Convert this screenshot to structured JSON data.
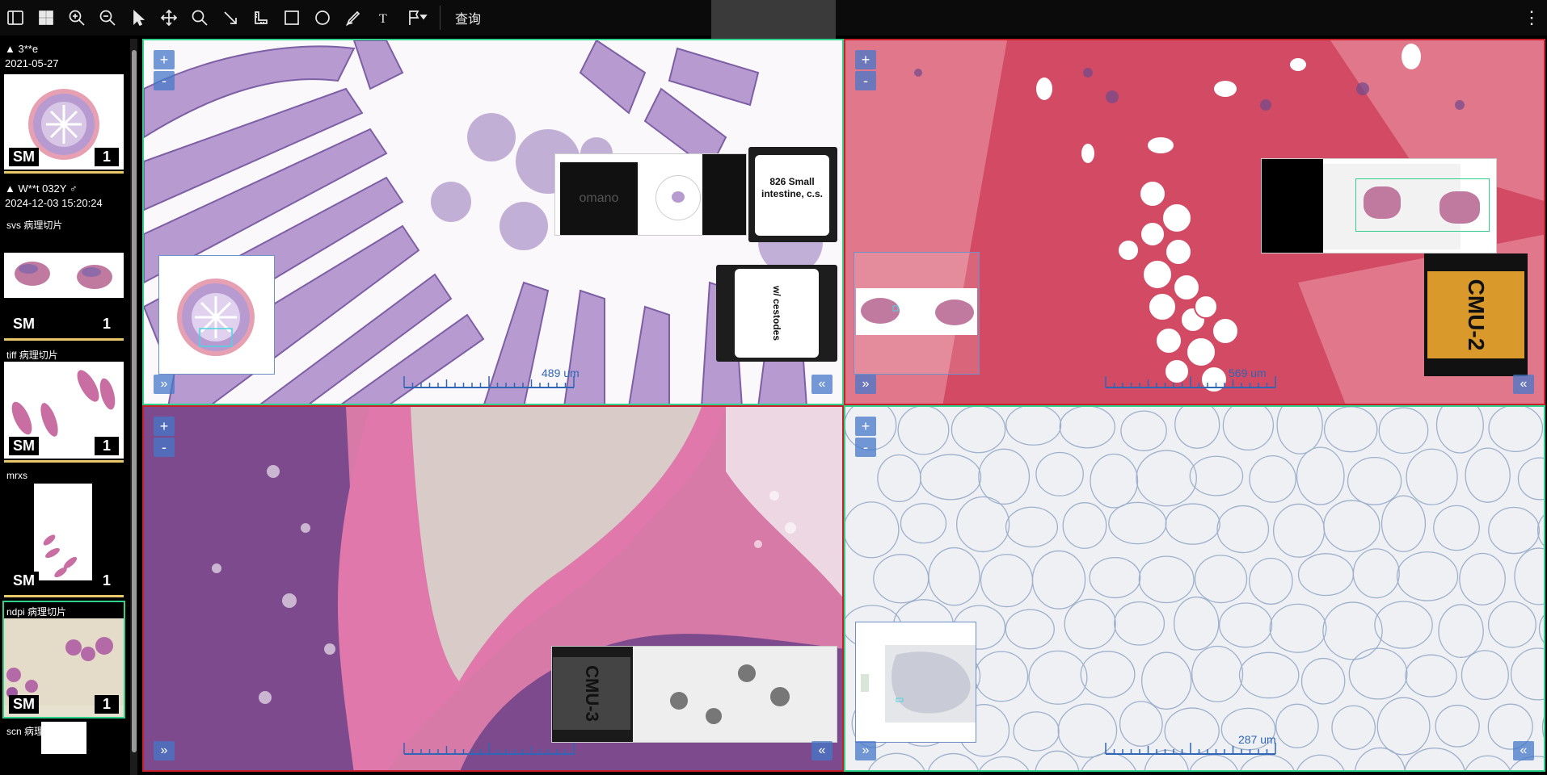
{
  "toolbar": {
    "tools": [
      {
        "name": "toggle-sidebar-icon"
      },
      {
        "name": "layout-grid-icon"
      },
      {
        "name": "zoom-in-icon"
      },
      {
        "name": "zoom-out-icon"
      },
      {
        "name": "select-pointer-icon"
      },
      {
        "name": "pan-move-icon"
      },
      {
        "name": "magnifier-icon"
      },
      {
        "name": "arrow-annotation-icon"
      },
      {
        "name": "ruler-icon"
      },
      {
        "name": "rectangle-icon"
      },
      {
        "name": "ellipse-icon"
      },
      {
        "name": "freehand-pen-icon"
      },
      {
        "name": "text-annotation-icon"
      },
      {
        "name": "flag-dropdown-icon"
      }
    ],
    "query_label": "查询",
    "more_icon": "kebab-menu-icon"
  },
  "sidebar": {
    "patients": [
      {
        "header": "▲ 3**e",
        "date": "2021-05-27",
        "studies": [
          {
            "label": "",
            "modality": "SM",
            "count": "1",
            "active": false
          }
        ]
      },
      {
        "header": "▲ W**t 032Y ♂",
        "date": "2024-12-03 15:20:24",
        "studies": [
          {
            "label": "svs 病理切片",
            "modality": "SM",
            "count": "1",
            "active": false
          },
          {
            "label": "tiff 病理切片",
            "modality": "SM",
            "count": "1",
            "active": false
          },
          {
            "label": "mrxs",
            "modality": "SM",
            "count": "1",
            "active": false
          },
          {
            "label": "ndpi 病理切片",
            "modality": "SM",
            "count": "1",
            "active": true
          },
          {
            "label": "scn 病理",
            "modality": "",
            "count": "",
            "active": false
          }
        ]
      }
    ]
  },
  "viewports": [
    {
      "id": "vp1",
      "scale_label": "489 um",
      "border": "#2fd28a",
      "plus": "+",
      "minus": "-",
      "nav_left": "»",
      "nav_right": "«"
    },
    {
      "id": "vp2",
      "scale_label": "569 um",
      "border": "#c8202a",
      "plus": "+",
      "minus": "-",
      "nav_left": "»",
      "nav_right": "«"
    },
    {
      "id": "vp3",
      "scale_label": "",
      "border": "#c8202a",
      "plus": "+",
      "minus": "-",
      "nav_left": "»",
      "nav_right": "«"
    },
    {
      "id": "vp4",
      "scale_label": "287 um",
      "border": "#2fd28a",
      "plus": "+",
      "minus": "-",
      "nav_left": "»",
      "nav_right": "«"
    }
  ],
  "slide_labels": {
    "vp1_brand": "omano",
    "vp1_label_text": "826 Small intestine, c.s.",
    "vp1_label_hand": "w/ cestodes",
    "vp2_cmu": "CMU-2",
    "vp3_cmu": "CMU-3"
  },
  "colors": {
    "accent_active": "#2fd28a",
    "accent_red": "#c8202a",
    "scale_blue": "#2f66b5",
    "study_underline": "#e8c86a"
  }
}
